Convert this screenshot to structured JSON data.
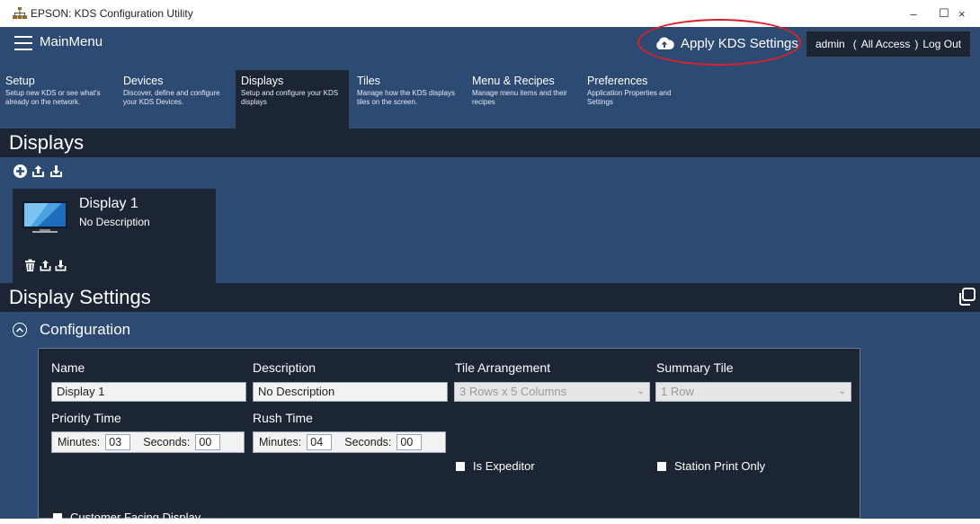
{
  "window": {
    "title": "EPSON: KDS Configuration Utility",
    "minimize": "–",
    "maximize": "☐",
    "close": "×"
  },
  "menubar": {
    "mainmenu_label": "MainMenu",
    "apply_label": "Apply KDS Settings",
    "user": {
      "name": "admin",
      "open_paren": "(",
      "access": "All Access",
      "close_paren": ")",
      "logout": "Log Out"
    }
  },
  "nav": [
    {
      "title": "Setup",
      "desc": "Setup new KDS or see what's already on the network."
    },
    {
      "title": "Devices",
      "desc": "Discover, define and configure your KDS Devices."
    },
    {
      "title": "Displays",
      "desc": "Setup and configure your KDS displays"
    },
    {
      "title": "Tiles",
      "desc": "Manage how the KDS displays tiles on the screen."
    },
    {
      "title": "Menu & Recipes",
      "desc": "Manage menu items and their recipes"
    },
    {
      "title": "Preferences",
      "desc": "Application Properties and Settings"
    }
  ],
  "displays": {
    "header": "Displays",
    "card": {
      "name": "Display 1",
      "description": "No Description"
    }
  },
  "settings": {
    "header": "Display Settings",
    "configuration_label": "Configuration",
    "labels": {
      "name": "Name",
      "description": "Description",
      "tile_arrangement": "Tile Arrangement",
      "summary_tile": "Summary Tile",
      "priority_time": "Priority Time",
      "rush_time": "Rush Time"
    },
    "values": {
      "name": "Display 1",
      "description": "No Description",
      "tile_arrangement": "3 Rows x 5 Columns",
      "summary_tile": "1 Row"
    },
    "priority": {
      "minutes_label": "Minutes:",
      "minutes": "03",
      "seconds_label": "Seconds:",
      "seconds": "00"
    },
    "rush": {
      "minutes_label": "Minutes:",
      "minutes": "04",
      "seconds_label": "Seconds:",
      "seconds": "00"
    },
    "checkboxes": {
      "is_expeditor": "Is Expeditor",
      "station_print_only": "Station Print Only",
      "customer_facing": "Customer Facing Display"
    }
  },
  "colors": {
    "app_bg": "#2d4a73",
    "dark_panel": "#1c2534",
    "annotation": "#d4242a"
  }
}
